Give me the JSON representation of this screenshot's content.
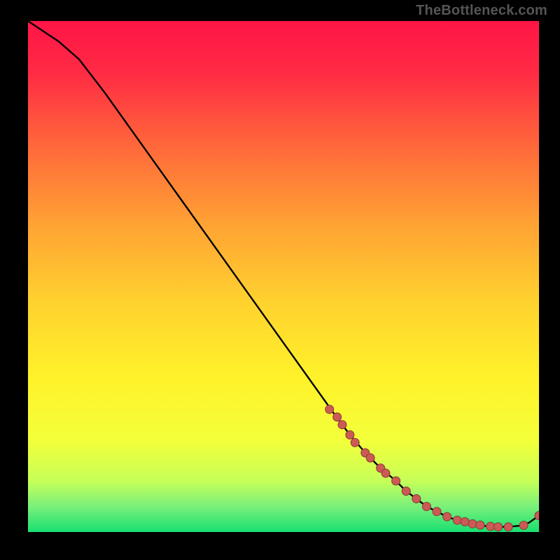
{
  "watermark": "TheBottleneck.com",
  "colors": {
    "background": "#000000",
    "gradient_top": "#ff1a4a",
    "gradient_mid": "#ffd200",
    "gradient_bottom": "#18e070",
    "curve": "#000000",
    "marker_fill": "#cc5a55",
    "marker_stroke": "#8a3a36"
  },
  "chart_data": {
    "type": "line",
    "title": "",
    "xlabel": "",
    "ylabel": "",
    "xlim": [
      0,
      100
    ],
    "ylim": [
      0,
      100
    ],
    "series": [
      {
        "name": "curve",
        "x": [
          0,
          3,
          6,
          10,
          15,
          20,
          25,
          30,
          35,
          40,
          45,
          50,
          55,
          60,
          63,
          66,
          69,
          72,
          74,
          76,
          78,
          80,
          82,
          84,
          86,
          88,
          90,
          92,
          94,
          96,
          98,
          100
        ],
        "y": [
          100,
          98,
          96,
          92.5,
          86,
          79,
          72,
          65,
          58,
          51,
          44,
          37,
          30,
          23,
          19,
          15.5,
          12.5,
          10,
          8,
          6.5,
          5,
          4,
          3,
          2.3,
          1.8,
          1.4,
          1.1,
          1.0,
          1.0,
          1.2,
          1.8,
          3.2
        ]
      },
      {
        "name": "markers",
        "x": [
          59,
          60.5,
          61.5,
          63,
          64,
          66,
          67,
          69,
          70,
          72,
          74,
          76,
          78,
          80,
          82,
          84,
          85.5,
          87,
          88.5,
          90.5,
          92,
          94,
          97,
          100
        ],
        "y": [
          24,
          22.5,
          21,
          19,
          17.5,
          15.5,
          14.5,
          12.5,
          11.5,
          10,
          8,
          6.5,
          5,
          4,
          3,
          2.3,
          2.0,
          1.6,
          1.35,
          1.1,
          1.0,
          1.0,
          1.3,
          3.2
        ]
      }
    ]
  }
}
